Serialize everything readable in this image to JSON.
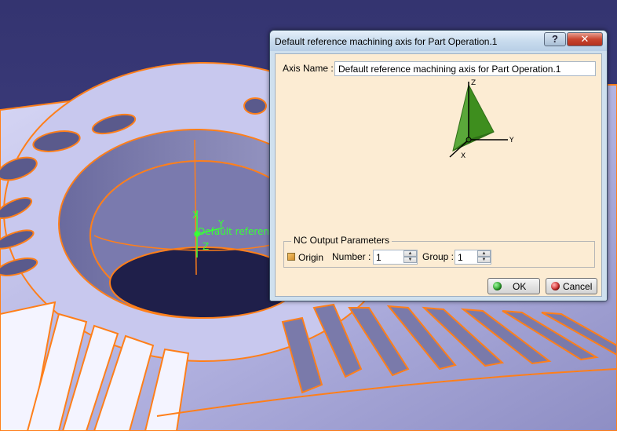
{
  "viewport": {
    "axis_labels": {
      "x": "X",
      "y": "Y",
      "z": "Z"
    },
    "axis_caption": "Default referen",
    "colors": {
      "background": "#363676",
      "part": "#b8b8e6",
      "edges": "#ff7f1a",
      "axis": "#38ff38"
    }
  },
  "dialog": {
    "title": "Default reference machining axis for Part Operation.1",
    "help_label": "?",
    "close_label": "✕",
    "axis_name_label": "Axis Name :",
    "axis_name_value": "Default reference machining axis for Part Operation.1",
    "axis_glyph": {
      "z_label": "Z",
      "y_label": "Y",
      "x_label": "X",
      "color": "#3e8e1e"
    },
    "nc_output": {
      "legend": "NC Output Parameters",
      "origin_label": "Origin",
      "number_label": "Number :",
      "number_value": "1",
      "group_label": "Group :",
      "group_value": "1"
    },
    "ok_label": "OK",
    "cancel_label": "Cancel",
    "colors": {
      "ok_icon": "#2aa52a",
      "cancel_icon": "#d22a2a"
    }
  }
}
